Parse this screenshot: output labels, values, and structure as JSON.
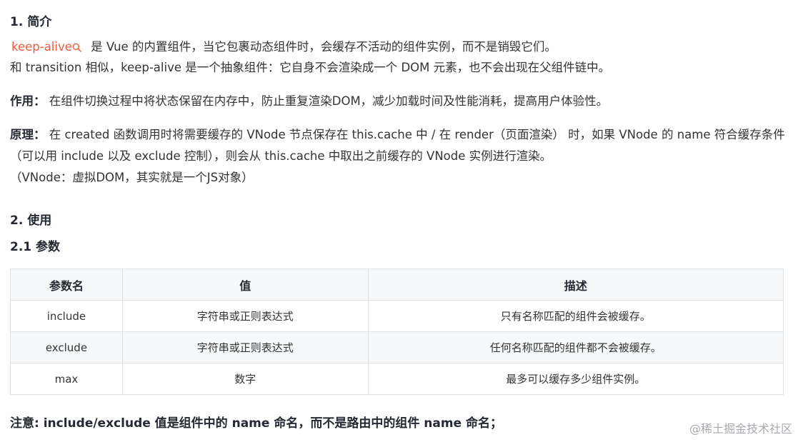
{
  "section1": {
    "heading": "1. 简介",
    "intro_keyword": "keep-alive",
    "intro_line1_rest": " 是 Vue 的内置组件，当它包裹动态组件时，会缓存不活动的组件实例，而不是销毁它们。",
    "intro_line2": "和 transition 相似，keep-alive 是一个抽象组件：它自身不会渲染成一个 DOM 元素，也不会出现在父组件链中。",
    "effect_label": "作用：",
    "effect_text": " 在组件切换过程中将状态保留在内存中，防止重复渲染DOM，减少加载时间及性能消耗，提高用户体验性。",
    "principle_label": "原理：",
    "principle_text": " 在 created 函数调用时将需要缓存的 VNode 节点保存在 this.cache 中 / 在 render（页面渲染） 时，如果 VNode 的 name 符合缓存条件（可以用 include 以及 exclude 控制），则会从 this.cache 中取出之前缓存的 VNode 实例进行渲染。",
    "principle_note": "（VNode：虚拟DOM，其实就是一个JS对象）"
  },
  "section2": {
    "heading": "2. 使用",
    "sub_heading": "2.1 参数"
  },
  "table": {
    "headers": [
      "参数名",
      "值",
      "描述"
    ],
    "rows": [
      [
        "include",
        "字符串或正则表达式",
        "只有名称匹配的组件会被缓存。"
      ],
      [
        "exclude",
        "字符串或正则表达式",
        "任何名称匹配的组件都不会被缓存。"
      ],
      [
        "max",
        "数字",
        "最多可以缓存多少组件实例。"
      ]
    ]
  },
  "note": "注意: include/exclude 值是组件中的 name 命名，而不是路由中的组件 name 命名；",
  "watermark": "@稀土掘金技术社区",
  "icons": {
    "keyword_search": "search-icon"
  },
  "colors": {
    "keyword": "#f05a3a",
    "table_header_bg": "#f6f8fa",
    "border": "#dfe2e5"
  }
}
